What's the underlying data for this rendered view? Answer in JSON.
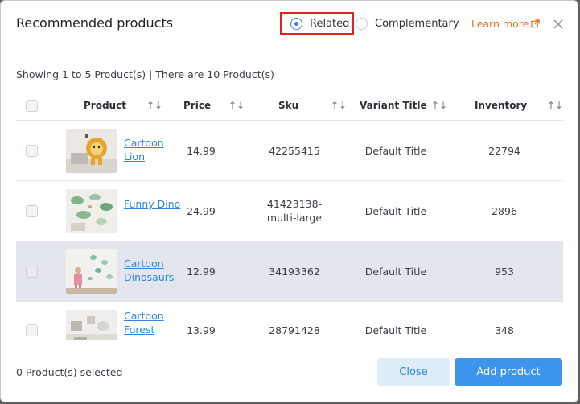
{
  "header": {
    "title": "Recommended products",
    "radio_related": "Related",
    "radio_complementary": "Complementary",
    "learn_more": "Learn more"
  },
  "summary": "Showing 1 to 5 Product(s) | There are 10 Product(s)",
  "table": {
    "columns": [
      "Product",
      "Price",
      "Sku",
      "Variant Title",
      "Inventory"
    ],
    "sort_glyph": "↑↓",
    "rows": [
      {
        "name": "Cartoon Lion",
        "price": "14.99",
        "sku": "42255415",
        "variant": "Default Title",
        "inventory": "22794"
      },
      {
        "name": "Funny Dino",
        "price": "24.99",
        "sku": "41423138-multi-large",
        "variant": "Default Title",
        "inventory": "2896"
      },
      {
        "name": "Cartoon Dinosaurs",
        "price": "12.99",
        "sku": "34193362",
        "variant": "Default Title",
        "inventory": "953"
      },
      {
        "name": "Cartoon Forest",
        "price": "13.99",
        "sku": "28791428",
        "variant": "Default Title",
        "inventory": "348"
      }
    ]
  },
  "footer": {
    "selected": "0 Product(s) selected",
    "close_label": "Close",
    "add_label": "Add product"
  },
  "colors": {
    "accent": "#2e86de",
    "learn_more": "#e4732a",
    "highlight_row": "#e4e6ee",
    "annotation": "#e3221d"
  }
}
